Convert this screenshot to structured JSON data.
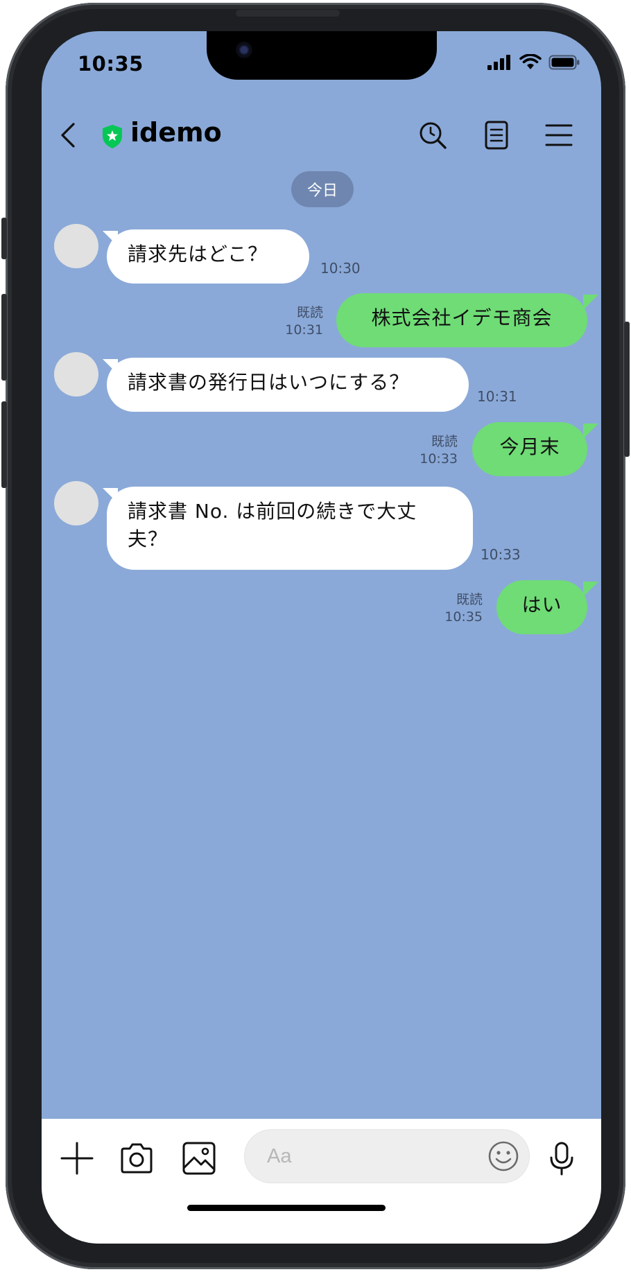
{
  "status_bar": {
    "time": "10:35"
  },
  "header": {
    "title": "idemo"
  },
  "date_separator": "今日",
  "messages": [
    {
      "side": "in",
      "text": "請求先はどこ？",
      "time": "10:30"
    },
    {
      "side": "out",
      "text": "株式会社イデモ商会",
      "read": "既読",
      "time": "10:31"
    },
    {
      "side": "in",
      "text": "請求書の発行日はいつにする？",
      "time": "10:31"
    },
    {
      "side": "out",
      "text": "今月末",
      "read": "既読",
      "time": "10:33"
    },
    {
      "side": "in",
      "text_line1": "請求書 No. は前回の続きで大丈",
      "text_line2": "夫？",
      "time": "10:33"
    },
    {
      "side": "out",
      "text": "はい",
      "read": "既読",
      "time": "10:35"
    }
  ],
  "input": {
    "placeholder": "Aa"
  },
  "colors": {
    "chat_background": "#8aa9d8",
    "outgoing_bubble": "#6fdc76",
    "incoming_bubble": "#ffffff",
    "verified_badge": "#06c755"
  },
  "icons": [
    "back-icon",
    "verified-shield-icon",
    "search-icon",
    "notes-icon",
    "menu-icon",
    "plus-icon",
    "camera-icon",
    "image-icon",
    "emoji-icon",
    "mic-icon"
  ]
}
